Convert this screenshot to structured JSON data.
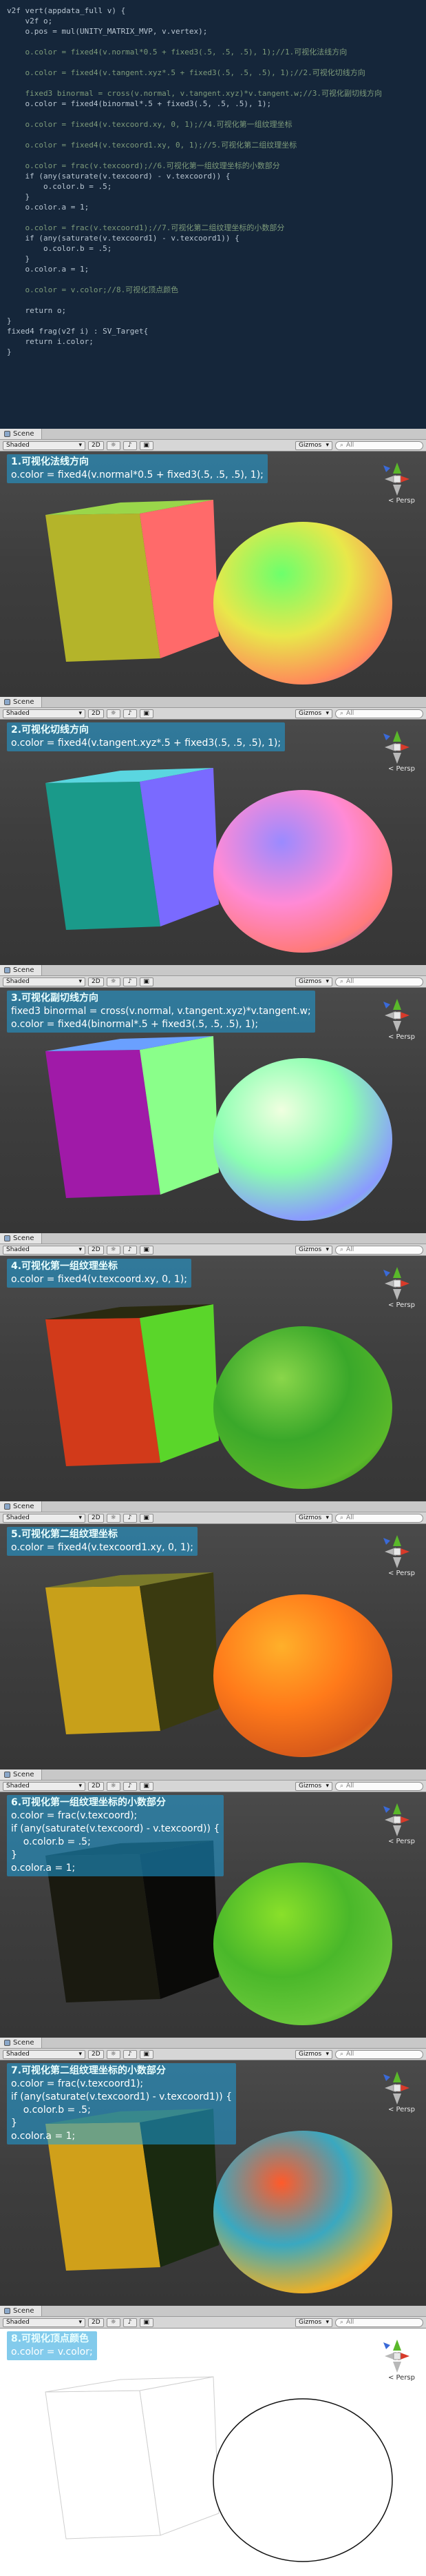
{
  "code": {
    "lines": [
      "v2f vert(appdata_full v) {",
      "    v2f o;",
      "    o.pos = mul(UNITY_MATRIX_MVP, v.vertex);",
      "",
      "    o.color = fixed4(v.normal*0.5 + fixed3(.5, .5, .5), 1);//1.可视化法线方向",
      "",
      "    o.color = fixed4(v.tangent.xyz*.5 + fixed3(.5, .5, .5), 1);//2.可视化切线方向",
      "",
      "    fixed3 binormal = cross(v.normal, v.tangent.xyz)*v.tangent.w;//3.可视化副切线方向",
      "    o.color = fixed4(binormal*.5 + fixed3(.5, .5, .5), 1);",
      "",
      "    o.color = fixed4(v.texcoord.xy, 0, 1);//4.可视化第一组纹理坐标",
      "",
      "    o.color = fixed4(v.texcoord1.xy, 0, 1);//5.可视化第二组纹理坐标",
      "",
      "    o.color = frac(v.texcoord);//6.可视化第一组纹理坐标的小数部分",
      "    if (any(saturate(v.texcoord) - v.texcoord)) {",
      "        o.color.b = .5;",
      "    }",
      "    o.color.a = 1;",
      "",
      "    o.color = frac(v.texcoord1);//7.可视化第二组纹理坐标的小数部分",
      "    if (any(saturate(v.texcoord1) - v.texcoord1)) {",
      "        o.color.b = .5;",
      "    }",
      "    o.color.a = 1;",
      "",
      "    o.color = v.color;//8.可视化顶点颜色",
      "",
      "    return o;",
      "}",
      "fixed4 frag(v2f i) : SV_Target{",
      "    return i.color;",
      "}"
    ]
  },
  "ui": {
    "tab_label": "Scene",
    "shaded_label": "Shaded",
    "mode_2d_label": "2D",
    "gizmos_label": "Gizmos",
    "search_placeholder": "All",
    "persp_label": "< Persp"
  },
  "panels": [
    {
      "caption": [
        "1.可视化法线方向",
        "o.color = fixed4(v.normal*0.5 + fixed3(.5, .5, .5), 1);"
      ],
      "cube": {
        "front": "#ff6a6a",
        "side": "#b4b42a",
        "top": "#9ad64a"
      },
      "sphere": [
        "#6cff6c",
        "#e8e84a",
        "#ff8a5a",
        "#c85a9a"
      ],
      "white": false
    },
    {
      "caption": [
        "2.可视化切线方向",
        "o.color = fixed4(v.tangent.xyz*.5 + fixed3(.5, .5, .5), 1);"
      ],
      "cube": {
        "front": "#7a6aff",
        "side": "#1a9a8a",
        "top": "#5ad6e0"
      },
      "sphere": [
        "#9a8aff",
        "#ff8ad6",
        "#ff7a7a",
        "#6a5ae0"
      ],
      "white": false
    },
    {
      "caption": [
        "3.可视化副切线方向",
        "fixed3 binormal = cross(v.normal, v.tangent.xyz)*v.tangent.w;",
        "o.color = fixed4(binormal*.5 + fixed3(.5, .5, .5), 1);"
      ],
      "cube": {
        "front": "#8aff8a",
        "side": "#a01aa8",
        "top": "#6aa0ff"
      },
      "sphere": [
        "#f0ffe0",
        "#8affb0",
        "#8a9aff",
        "#6aff7a"
      ],
      "white": false
    },
    {
      "caption": [
        "4.可视化第一组纹理坐标",
        "o.color = fixed4(v.texcoord.xy, 0, 1);"
      ],
      "cube": {
        "front": "#5ad62a",
        "side": "#d23a1a",
        "top": "#2a2a10"
      },
      "sphere": [
        "#8ad64a",
        "#3aa82a",
        "#5ab82a",
        "#2a7a1a"
      ],
      "white": false
    },
    {
      "caption": [
        "5.可视化第二组纹理坐标",
        "o.color = fixed4(v.texcoord1.xy, 0, 1);"
      ],
      "cube": {
        "front": "#3a3a10",
        "side": "#c8a01a",
        "top": "#7a7a2a"
      },
      "sphere": [
        "#ffb02a",
        "#ff7a1a",
        "#d85a1a",
        "#e0a02a"
      ],
      "white": false
    },
    {
      "caption": [
        "6.可视化第一组纹理坐标的小数部分",
        "o.color = frac(v.texcoord);",
        "if (any(saturate(v.texcoord) - v.texcoord)) {",
        "    o.color.b = .5;",
        "}",
        "o.color.a = 1;"
      ],
      "cube": {
        "front": "#0a0a08",
        "side": "#1a1a10",
        "top": "#101008"
      },
      "sphere": [
        "#8ae02a",
        "#4ab82a",
        "#6ac83a",
        "#2a8a1a"
      ],
      "white": false
    },
    {
      "caption": [
        "7.可视化第二组纹理坐标的小数部分",
        "o.color = frac(v.texcoord1);",
        "if (any(saturate(v.texcoord1) - v.texcoord1)) {",
        "    o.color.b = .5;",
        "}",
        "o.color.a = 1;"
      ],
      "cube": {
        "front": "#1a2a10",
        "side": "#d0a01a",
        "top": "#5a6a2a"
      },
      "sphere": [
        "#ff5a2a",
        "#3aa8c0",
        "#e8b02a",
        "#ff7a1a"
      ],
      "white": false
    },
    {
      "caption": [
        "8.可视化顶点颜色",
        "o.color = v.color;"
      ],
      "cube": {
        "front": "#ffffff",
        "side": "#ffffff",
        "top": "#ffffff"
      },
      "sphere": [
        "#ffffff",
        "#ffffff",
        "#ffffff",
        "#ffffff"
      ],
      "white": true
    }
  ]
}
